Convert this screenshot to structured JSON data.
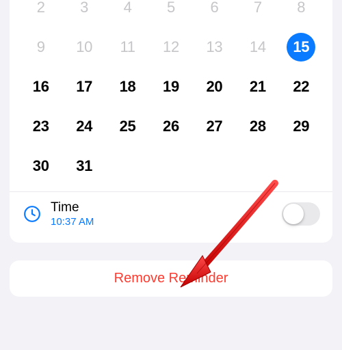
{
  "calendar": {
    "previous_days": [
      2,
      3,
      4,
      5,
      6,
      7,
      8,
      9,
      10,
      11,
      12,
      13,
      14
    ],
    "selected_day": 15,
    "current_days": [
      16,
      17,
      18,
      19,
      20,
      21,
      22,
      23,
      24,
      25,
      26,
      27,
      28,
      29,
      30,
      31
    ]
  },
  "time": {
    "label": "Time",
    "value": "10:37 AM",
    "enabled": false
  },
  "remove": {
    "label": "Remove Reminder"
  },
  "colors": {
    "accent": "#0a7aff",
    "destructive": "#ff3b30",
    "background": "#f2f2f7"
  }
}
